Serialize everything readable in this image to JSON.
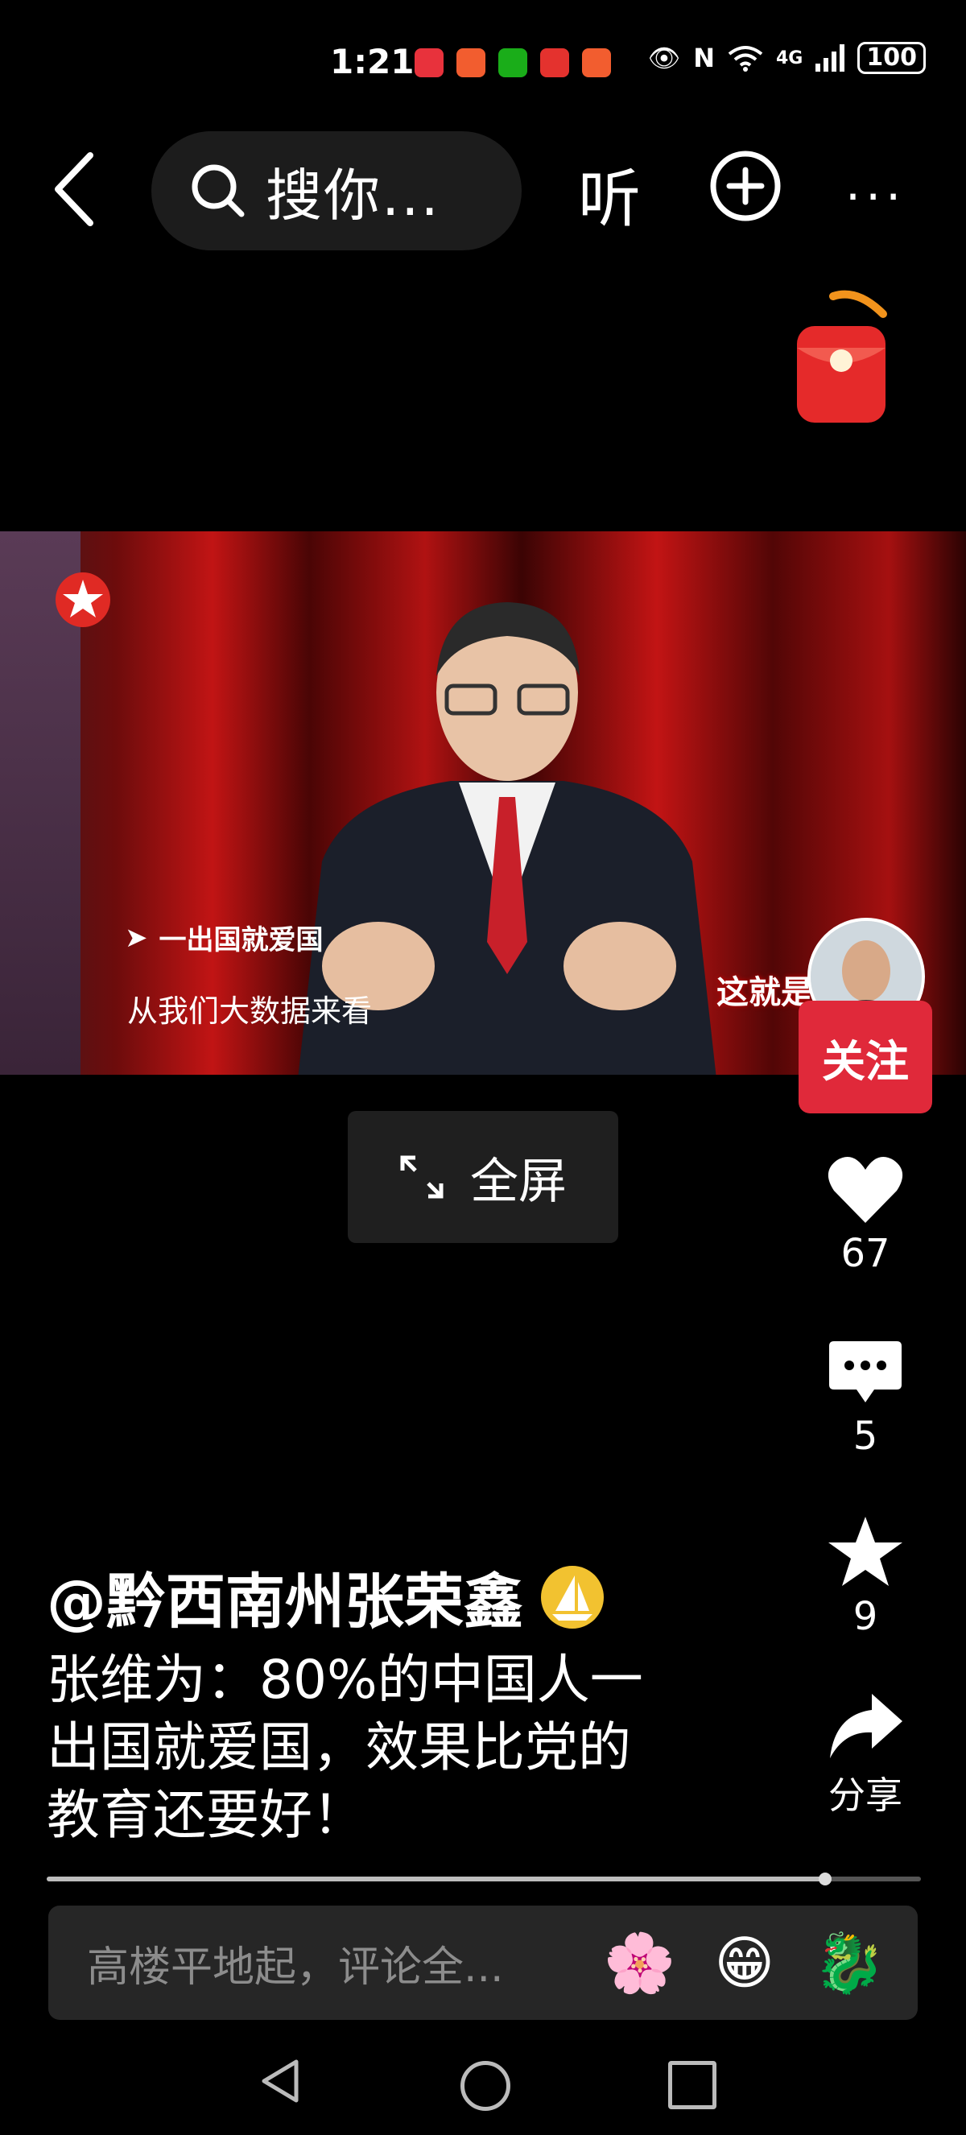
{
  "status_bar": {
    "time": "1:21",
    "app_badges": [
      {
        "name": "huawei-app-icon",
        "color": "#e8323c"
      },
      {
        "name": "game-app-icon",
        "color": "#f25d2f"
      },
      {
        "name": "wechat-icon",
        "color": "#1aad19"
      },
      {
        "name": "toutiao-icon",
        "color": "#e4322e"
      },
      {
        "name": "video-app-icon",
        "color": "#f25d2f"
      }
    ],
    "network": "4G",
    "battery": "100"
  },
  "top_bar": {
    "search_text": "搜你...",
    "listen_label": "听",
    "more_label": "···"
  },
  "video": {
    "topic_tag": "一出国就爱国",
    "caption": "从我们大数据来看",
    "show_mark": "这就是"
  },
  "fullscreen_label": "全屏",
  "right_rail": {
    "follow_label": "关注",
    "likes": "67",
    "comments": "5",
    "favorites": "9",
    "share_label": "分享"
  },
  "post": {
    "author": "@黔西南州张荣鑫",
    "description_lines": [
      "张维为：80%的中国人一",
      "出国就爱国，效果比党的",
      "教育还要好！"
    ]
  },
  "progress": {
    "fraction": 0.89
  },
  "comment_bar": {
    "placeholder": "高楼平地起，评论全...",
    "emojis": [
      "🌸",
      "😁",
      "🐉"
    ]
  },
  "colors": {
    "accent_red": "#e0293a",
    "background": "#000000",
    "pill_bg": "#1c1c1c"
  }
}
